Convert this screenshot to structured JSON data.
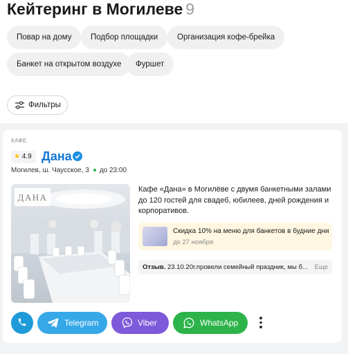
{
  "header": {
    "title": "Кейтеринг в Могилеве",
    "count": "9"
  },
  "chips": [
    "Повар на дому",
    "Подбор площадки",
    "Организация кофе-брейка",
    "Банкет на открытом воздухе",
    "Фуршет"
  ],
  "filters": {
    "label": "Фильтры",
    "icon": "sliders-icon"
  },
  "card": {
    "category": "КАФЕ",
    "rating": "4.9",
    "name": "Дана",
    "address": "Могилев, ш. Чаусское, 3",
    "hours": "до 23:00",
    "photo_logo": "ДАНА",
    "description": "Кафе «Дана» в Могилёве с двумя банкетными залами до 120 гостей для свадеб, юбилеев, дней рождения и корпоративов.",
    "promo": {
      "title": "Скидка 10% на меню для банкетов в будние дни",
      "date": "до 27 ноября"
    },
    "review": {
      "label": "Отзыв.",
      "text": "23.10.20г.провели семейный праздник, мы б...",
      "more": "Еще"
    }
  },
  "actions": {
    "telegram": "Telegram",
    "viber": "Viber",
    "whatsapp": "WhatsApp"
  },
  "colors": {
    "link": "#1477d4",
    "telegram": "#36a8e8",
    "viber": "#7c5ad9",
    "whatsapp": "#2cb34a",
    "promo_bg": "#fff7e2"
  }
}
